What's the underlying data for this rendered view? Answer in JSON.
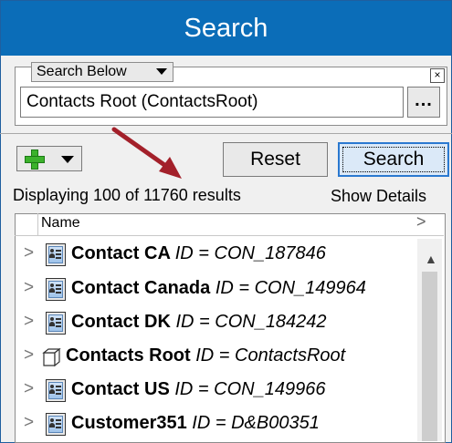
{
  "header": {
    "title": "Search"
  },
  "scope": {
    "dropdown_label": "Search Below",
    "close_glyph": "×",
    "path_value": "Contacts Root (ContactsRoot)",
    "browse_label": "..."
  },
  "toolbar": {
    "add_icon": "green-plus-icon",
    "reset_label": "Reset",
    "search_label": "Search"
  },
  "results": {
    "status": "Displaying 100 of 11760 results",
    "show_details": "Show Details",
    "column_name": "Name",
    "column_chevron": ">",
    "rows": [
      {
        "name": "Contact CA",
        "id": "ID = CON_187846",
        "icon": "contact-card-icon"
      },
      {
        "name": "Contact Canada",
        "id": "ID = CON_149964",
        "icon": "contact-card-icon"
      },
      {
        "name": "Contact DK",
        "id": "ID = CON_184242",
        "icon": "contact-card-icon"
      },
      {
        "name": "Contacts Root",
        "id": "ID = ContactsRoot",
        "icon": "cube-icon"
      },
      {
        "name": "Contact US",
        "id": "ID = CON_149966",
        "icon": "contact-card-icon"
      },
      {
        "name": "Customer351",
        "id": "ID = D&B00351",
        "icon": "contact-card-icon"
      }
    ]
  },
  "colors": {
    "header_bg": "#0b6db8",
    "annotation_arrow": "#a3202a",
    "accent": "#2b79d0"
  }
}
